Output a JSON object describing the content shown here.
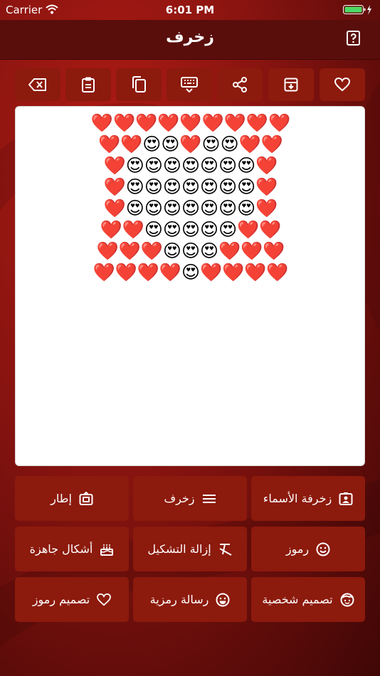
{
  "status_bar": {
    "carrier": "Carrier",
    "time": "6:01 PM"
  },
  "nav": {
    "title": "زخرف",
    "help_icon": "help-icon"
  },
  "toolbar": [
    {
      "name": "delete-button",
      "icon": "backspace-icon"
    },
    {
      "name": "paste-button",
      "icon": "clipboard-icon"
    },
    {
      "name": "copy-button",
      "icon": "copy-icon"
    },
    {
      "name": "keyboard-button",
      "icon": "keyboard-icon"
    },
    {
      "name": "share-button",
      "icon": "share-icon"
    },
    {
      "name": "archive-button",
      "icon": "archive-icon"
    },
    {
      "name": "favorite-button",
      "icon": "heart-icon"
    }
  ],
  "editor": {
    "text": "❤️❤️❤️❤️❤️❤️❤️❤️❤️\n❤️❤️😍😍❤️😍😍❤️❤️\n❤️😍😍😍😍😍😍😍❤️\n❤️😍😍😍😍😍😍😍❤️\n❤️😍😍😍😍😍😍😍❤️\n❤️❤️😍😍😍😍😍❤️❤️\n❤️❤️❤️😍😍😍❤️❤️❤️\n❤️❤️❤️❤️😍❤️❤️❤️❤️"
  },
  "actions": {
    "row1": {
      "names": "زخرفة الأسماء",
      "decorate": "زخرف",
      "frame": "إطار"
    },
    "row2": {
      "symbols": "رموز",
      "remove_diacritics": "إزالة التشكيل",
      "ready_shapes": "أشكال جاهزة"
    },
    "row3": {
      "personal_design": "تصميم شخصية",
      "symbolic_message": "رسالة رمزية",
      "symbols_design": "تصميم رموز"
    }
  }
}
